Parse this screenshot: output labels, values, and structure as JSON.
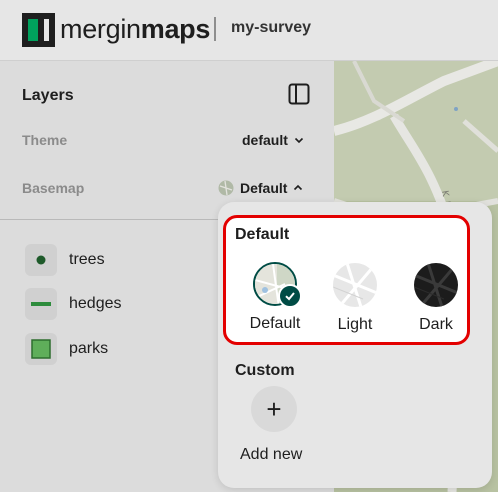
{
  "header": {
    "brand_regular": "mergin",
    "brand_bold": "maps",
    "project": "my-survey"
  },
  "panel": {
    "title": "Layers",
    "theme_label": "Theme",
    "theme_value": "default",
    "basemap_label": "Basemap",
    "basemap_value": "Default"
  },
  "layers": [
    {
      "name": "trees",
      "icon": "point-symbol-icon"
    },
    {
      "name": "hedges",
      "icon": "line-symbol-icon"
    },
    {
      "name": "parks",
      "icon": "polygon-symbol-icon"
    }
  ],
  "basemap_menu": {
    "default_section": "Default",
    "options": [
      {
        "label": "Default",
        "selected": true
      },
      {
        "label": "Light",
        "selected": false
      },
      {
        "label": "Dark",
        "selected": false
      }
    ],
    "custom_section": "Custom",
    "add_label": "Add new",
    "add_symbol": "+"
  },
  "colors": {
    "brand_dark": "#004c45",
    "brand_green": "#00a15d",
    "highlight": "#e30000",
    "layer_green": "#2d8c3c"
  }
}
